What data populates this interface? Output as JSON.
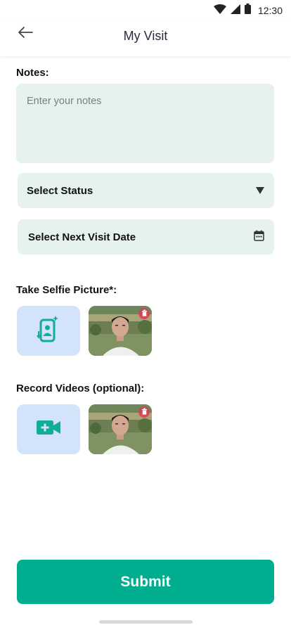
{
  "status_bar": {
    "time": "12:30"
  },
  "header": {
    "title": "My Visit"
  },
  "notes": {
    "label": "Notes:",
    "placeholder": "Enter your notes"
  },
  "status_select": {
    "label": "Select Status"
  },
  "next_visit": {
    "label": "Select Next Visit Date"
  },
  "selfie": {
    "label": "Take Selfie Picture*:"
  },
  "videos": {
    "label": "Record Videos (optional):"
  },
  "submit": {
    "label": "Submit"
  },
  "colors": {
    "accent": "#00ad8f",
    "field_bg": "#e6f2ee",
    "add_tile_bg": "#d3e3f9",
    "icon_teal": "#0fae95"
  },
  "icons": [
    "back-arrow-icon",
    "wifi-icon",
    "signal-icon",
    "battery-icon",
    "dropdown-caret-icon",
    "calendar-icon",
    "selfie-camera-icon",
    "video-camera-icon",
    "delete-icon"
  ]
}
